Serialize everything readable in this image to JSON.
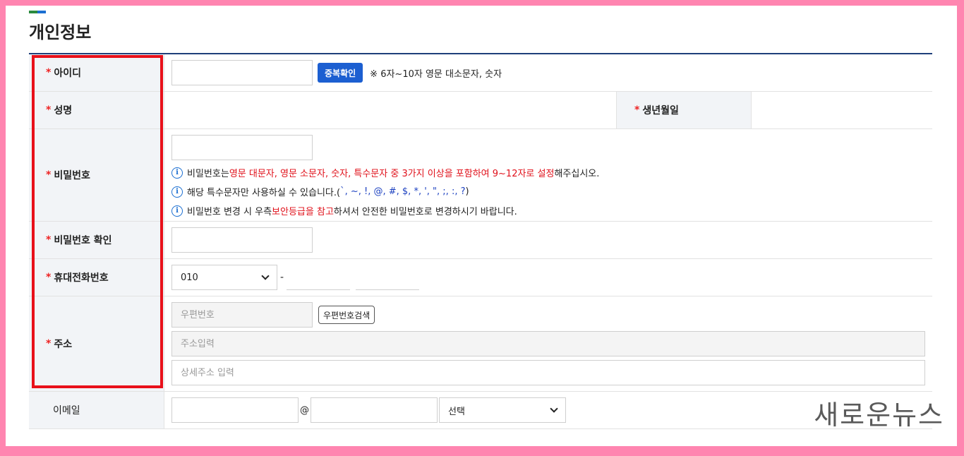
{
  "section": {
    "title": "개인정보"
  },
  "fields": {
    "id": {
      "label": "아이디",
      "button": "중복확인",
      "note": "※ 6자~10자 영문 대소문자, 숫자"
    },
    "name": {
      "label": "성명"
    },
    "birth": {
      "label": "생년월일"
    },
    "password": {
      "label": "비밀번호",
      "hint1": {
        "a": "비밀번호는 ",
        "b": "영문 대문자, 영문 소문자, 숫자, 특수문자 중 3가지 이상을 포함하여 9~12자로 설정",
        "c": "해주십시오."
      },
      "hint2": {
        "a": "해당 특수문자만 사용하실 수 있습니다.( ",
        "b": "`,  ~,  !,  @,  #,  $,  *,  ',  \",  ;,  :,  ?",
        "c": ")"
      },
      "hint3": {
        "a": "비밀번호 변경 시 우측 ",
        "b": "보안등급을 참고",
        "c": "하셔서 안전한 비밀번호로 변경하시기 바랍니다."
      }
    },
    "password_confirm": {
      "label": "비밀번호 확인"
    },
    "phone": {
      "label": "휴대전화번호",
      "prefix_selected": "010",
      "separator": "-"
    },
    "address": {
      "label": "주소",
      "zip_placeholder": "우편번호",
      "search_button": "우편번호검색",
      "addr_placeholder": "주소입력",
      "detail_placeholder": "상세주소 입력"
    },
    "email": {
      "label": "이메일",
      "at": "@",
      "domain_selected": "선택"
    }
  },
  "required_mark": "*",
  "watermark": "새로운뉴스",
  "colors": {
    "accent_blue": "#1c5fd1",
    "required_red": "#e0101a",
    "highlight_red": "#e8101a",
    "frame_pink": "#ff85b0"
  }
}
